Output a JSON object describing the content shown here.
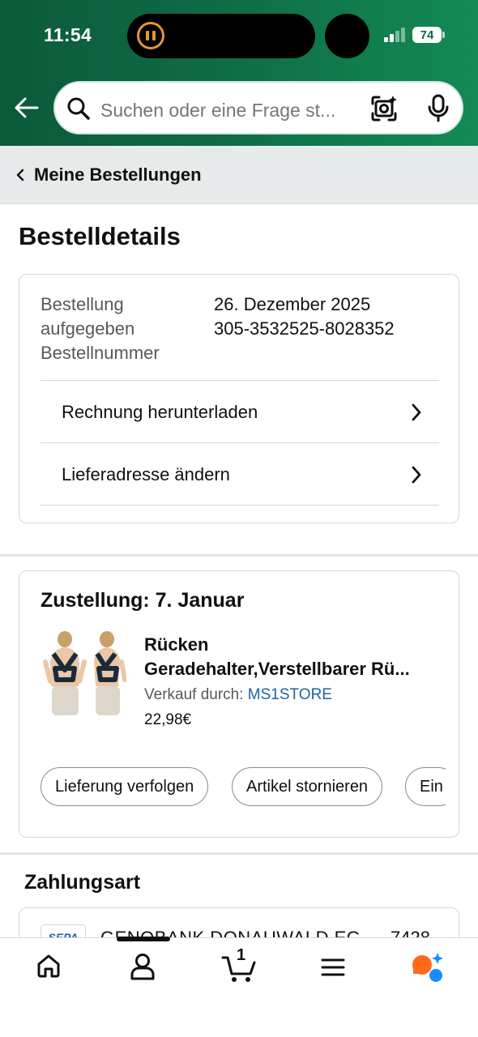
{
  "status_bar": {
    "time": "11:54",
    "battery": "74"
  },
  "search": {
    "placeholder": "Suchen oder eine Frage st..."
  },
  "breadcrumb": {
    "label": "Meine Bestellungen"
  },
  "page": {
    "title": "Bestelldetails"
  },
  "order": {
    "labels": [
      "Bestellung aufgegeben",
      "Bestellnummer"
    ],
    "date": "26. Dezember 2025",
    "number": "305-3532525-8028352",
    "links": [
      {
        "label": "Rechnung herunterladen",
        "icon": "chevron-right-icon"
      },
      {
        "label": "Lieferadresse ändern",
        "icon": "chevron-right-icon"
      }
    ]
  },
  "delivery": {
    "title": "Zustellung: 7. Januar",
    "product": {
      "name_line1": "Rücken",
      "name_line2": "Geradehalter,Verstellbarer Rü...",
      "seller_prefix": "Verkauf durch: ",
      "seller": "MS1STORE",
      "price": "22,98€"
    },
    "actions": [
      "Lieferung verfolgen",
      "Artikel stornieren",
      "Ein"
    ]
  },
  "payment": {
    "title": "Zahlungsart",
    "logo": "SEPA",
    "bank": "GENOBANK DONAUWALD EG",
    "number": "7428"
  },
  "nav": {
    "cart_count": "1",
    "items": [
      "home-icon",
      "account-icon",
      "cart-icon",
      "menu-icon",
      "rufus-ai-icon"
    ]
  },
  "colors": {
    "header_green": "#0e6b45",
    "link_blue": "#2162a1",
    "timer_orange": "#e09a2a",
    "rufus_orange": "#ff6a1a",
    "rufus_blue": "#1a8cff"
  }
}
